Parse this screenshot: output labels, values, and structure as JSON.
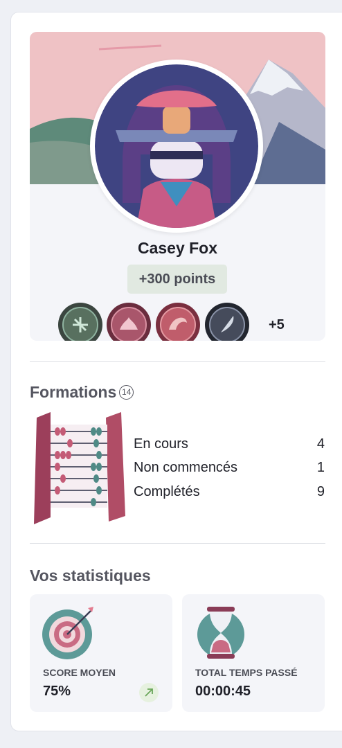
{
  "profile": {
    "name": "Casey Fox",
    "points": "+300 points",
    "badges": [
      {
        "icon": "shuriken-badge-icon",
        "color": "#4f6a5b"
      },
      {
        "icon": "lotus-badge-icon",
        "color": "#a34f67"
      },
      {
        "icon": "dragon-badge-icon",
        "color": "#b8586a"
      },
      {
        "icon": "feather-badge-icon",
        "color": "#3c4251"
      }
    ],
    "badges_more": "+5"
  },
  "formations": {
    "title": "Formations",
    "count": "14",
    "rows": [
      {
        "label": "En cours",
        "value": "4"
      },
      {
        "label": "Non commencés",
        "value": "1"
      },
      {
        "label": "Complétés",
        "value": "9"
      }
    ]
  },
  "stats": {
    "title": "Vos statistiques",
    "score": {
      "label": "SCORE MOYEN",
      "value": "75%",
      "trend_icon": "arrow-up-right-icon"
    },
    "time": {
      "label": "TOTAL TEMPS PASSÉ",
      "value": "00:00:45"
    }
  },
  "colors": {
    "accent_green": "#e1e9e1",
    "panel": "#f4f5f9"
  }
}
